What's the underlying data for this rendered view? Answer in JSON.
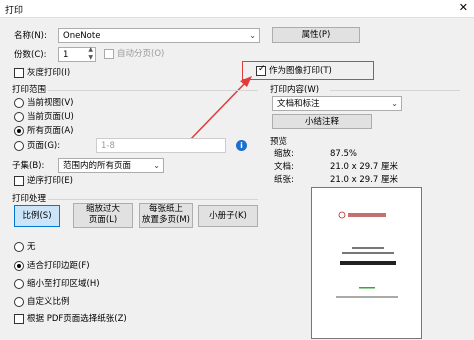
{
  "window": {
    "title": "打印"
  },
  "printer": {
    "name_label": "名称(N):",
    "name_value": "OneNote",
    "properties_button": "属性(P)",
    "copies_label": "份数(C):",
    "copies_value": "1",
    "collate_label": "自动分页(O)",
    "grayscale_label": "灰度打印(I)",
    "print_as_image_label": "作为图像打印(T)"
  },
  "range": {
    "header": "打印范围",
    "options": [
      "当前视图(V)",
      "当前页面(U)",
      "所有页面(A)",
      "页面(G):"
    ],
    "selected": "所有页面(A)",
    "pages_placeholder": "1-8",
    "subset_label": "子集(B):",
    "subset_value": "范围内的所有页面",
    "reverse_label": "逆序打印(E)"
  },
  "content": {
    "header": "打印内容(W)",
    "value": "文档和标注",
    "summarize_button": "小结注释"
  },
  "handling": {
    "header": "打印处理",
    "buttons": [
      "比例(S)",
      "缩放过大\n页面(L)",
      "每张纸上\n放置多页(M)",
      "小册子(K)"
    ],
    "selected": "比例(S)",
    "scale_options": [
      "无",
      "适合打印边距(F)",
      "缩小至打印区域(H)",
      "自定义比例"
    ],
    "scale_selected": "适合打印边距(F)",
    "paper_source_label": "根据 PDF页面选择纸张(Z)"
  },
  "preview": {
    "header": "预览",
    "rows": [
      {
        "label": "缩放:",
        "value": "87.5%"
      },
      {
        "label": "文档:",
        "value": "21.0 x 29.7 厘米"
      },
      {
        "label": "纸张:",
        "value": "21.0 x 29.7 厘米"
      }
    ]
  },
  "colors": {
    "annotation_red": "#e23b3b",
    "accent_blue": "#0078d7"
  },
  "icons": {
    "info": "info-icon",
    "dropdown": "chevron-down-icon",
    "close": "close-icon"
  }
}
